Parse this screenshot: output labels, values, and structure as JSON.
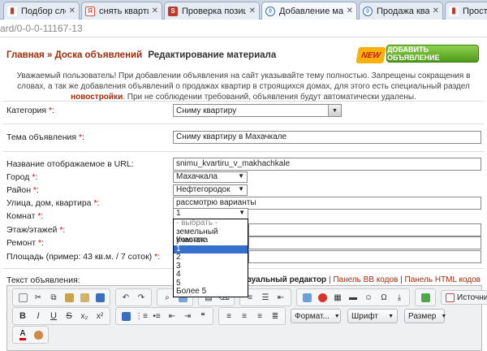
{
  "browser": {
    "tabs": [
      {
        "title": "Подбор слов",
        "icon": "bar-chart-icon",
        "color": "#c0392b"
      },
      {
        "title": "снять квартиру",
        "icon": "yandex-icon",
        "color": "#e74c3c"
      },
      {
        "title": "Проверка позиций",
        "icon": "s-logo-icon",
        "color": "#c0392b"
      },
      {
        "title": "Добавление материала",
        "icon": "site-icon",
        "color": "#2f6fc0"
      },
      {
        "title": "Продажа квартир",
        "icon": "site-icon",
        "color": "#2f6fc0"
      },
      {
        "title": "Простая",
        "icon": "bar-chart-icon",
        "color": "#c0392b"
      }
    ],
    "url": "ard/0-0-0-11167-13"
  },
  "breadcrumb": {
    "home": "Главная",
    "sep": "»",
    "board": "Доска объявлений",
    "current": "Редактирование материала"
  },
  "badges": {
    "new": "NEW",
    "add_button": "ДОБАВИТЬ ОБЪЯВЛЕНИЕ"
  },
  "notice": {
    "text1": "Уважаемый пользователь! При добавлении объявления на сайт указывайте тему полностью. Запрещены сокращения в словах, а так же добавления объявлений о продажах квартир в строящихся домах, для этого есть специальный раздел ",
    "link": "новостройки",
    "text2": ". При не соблюдении требований, объявления будут автоматически удалены."
  },
  "form": {
    "category": {
      "label": "Категория",
      "value": "Сниму квартиру"
    },
    "title": {
      "label": "Тема объявления",
      "value": "Сниму квартиру в Махачкале"
    },
    "url_name": {
      "label": "Название отображаемое в URL:",
      "value": "snimu_kvartiru_v_makhachkale"
    },
    "city": {
      "label": "Город",
      "value": "Махачкала"
    },
    "district": {
      "label": "Район",
      "value": "Нефтегородок"
    },
    "street": {
      "label": "Улица, дом, квартира",
      "value": "рассмотрю варианты"
    },
    "rooms": {
      "label": "Комнат",
      "value": "1",
      "options": [
        "- выбрать -",
        "земельный участок",
        "Комната",
        "1",
        "2",
        "3",
        "4",
        "5",
        "Более 5"
      ],
      "highlighted": "1"
    },
    "floor": {
      "label": "Этаж/этажей"
    },
    "repair": {
      "label": "Ремонт"
    },
    "area": {
      "label": "Площадь (пример: 43 кв.м. / 7 соток)"
    },
    "required_mark": "*",
    "colon": ":"
  },
  "editor": {
    "label": "Текст объявления:",
    "mode_visual": "Визуальный редактор",
    "mode_bb": "Панель BB кодов",
    "mode_html": "Панель HTML кодов",
    "divider": "|",
    "source_label": "Источник",
    "format_label": "Формат...",
    "font_label": "Шрифт",
    "size_label": "Размер",
    "bold": "B",
    "italic": "I",
    "underline": "U",
    "strike": "S",
    "sub": "x₂",
    "sup": "x²",
    "omega": "Ω",
    "color_a": "A"
  }
}
